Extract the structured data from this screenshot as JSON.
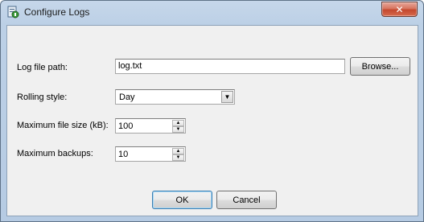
{
  "window": {
    "title": "Configure Logs",
    "close_glyph": "✕",
    "icon": "app-logs-icon"
  },
  "form": {
    "log_path": {
      "label": "Log file path:",
      "value": "log.txt",
      "browse_label": "Browse..."
    },
    "rolling_style": {
      "label": "Rolling style:",
      "value": "Day",
      "arrow_glyph": "▼"
    },
    "max_file_size": {
      "label": "Maximum file size (kB):",
      "value": "100"
    },
    "max_backups": {
      "label": "Maximum backups:",
      "value": "10"
    },
    "spin_up_glyph": "▲",
    "spin_down_glyph": "▼"
  },
  "buttons": {
    "ok": "OK",
    "cancel": "Cancel"
  },
  "colors": {
    "close_button": "#c4482e",
    "title_bar": "#c6d7ea",
    "client_background": "#f0f0f0"
  }
}
